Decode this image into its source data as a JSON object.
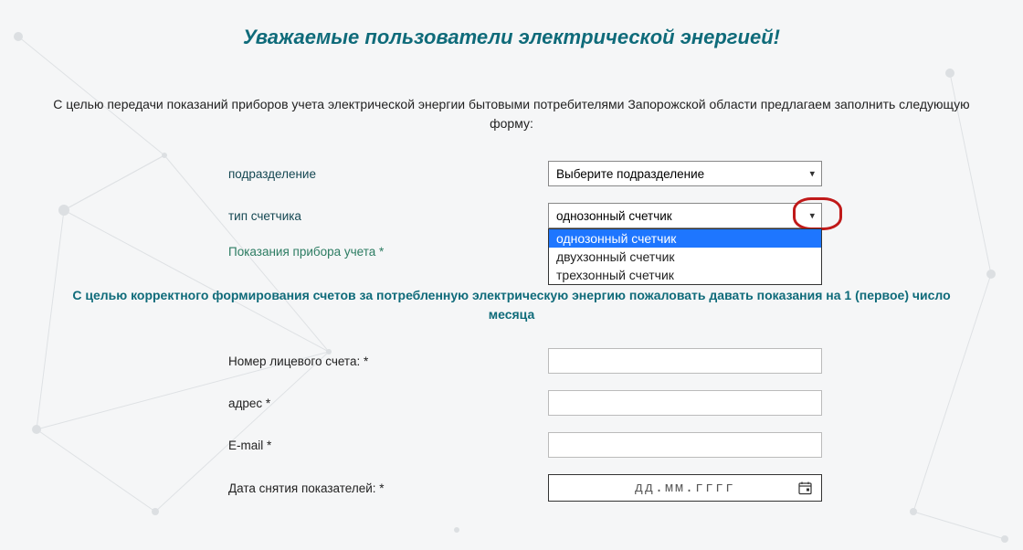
{
  "title": "Уважаемые пользователи электрической энергией!",
  "intro": "С целью передачи показаний приборов учета электрической энергии бытовыми потребителями Запорожской области предлагаем заполнить следующую форму:",
  "labels": {
    "subdivision": "подразделение",
    "meter_type": "тип счетчика",
    "readings": "Показания прибора учета *",
    "account": "Номер лицевого счета: *",
    "address": "адрес *",
    "email": "E-mail *",
    "date": "Дата снятия показателей: *"
  },
  "subdivision_select": {
    "value": "Выберите подразделение"
  },
  "meter_type_select": {
    "value": "однозонный счетчик",
    "options": [
      "однозонный счетчик",
      "двухзонный счетчик",
      "трехзонный счетчик"
    ],
    "highlight_index": 0
  },
  "mid_note": "С целью корректного формирования счетов за потребленную электрическую энергию пожаловать давать показания на 1 (первое) число месяца",
  "date_input": {
    "placeholder": "дд.мм.гггг"
  }
}
